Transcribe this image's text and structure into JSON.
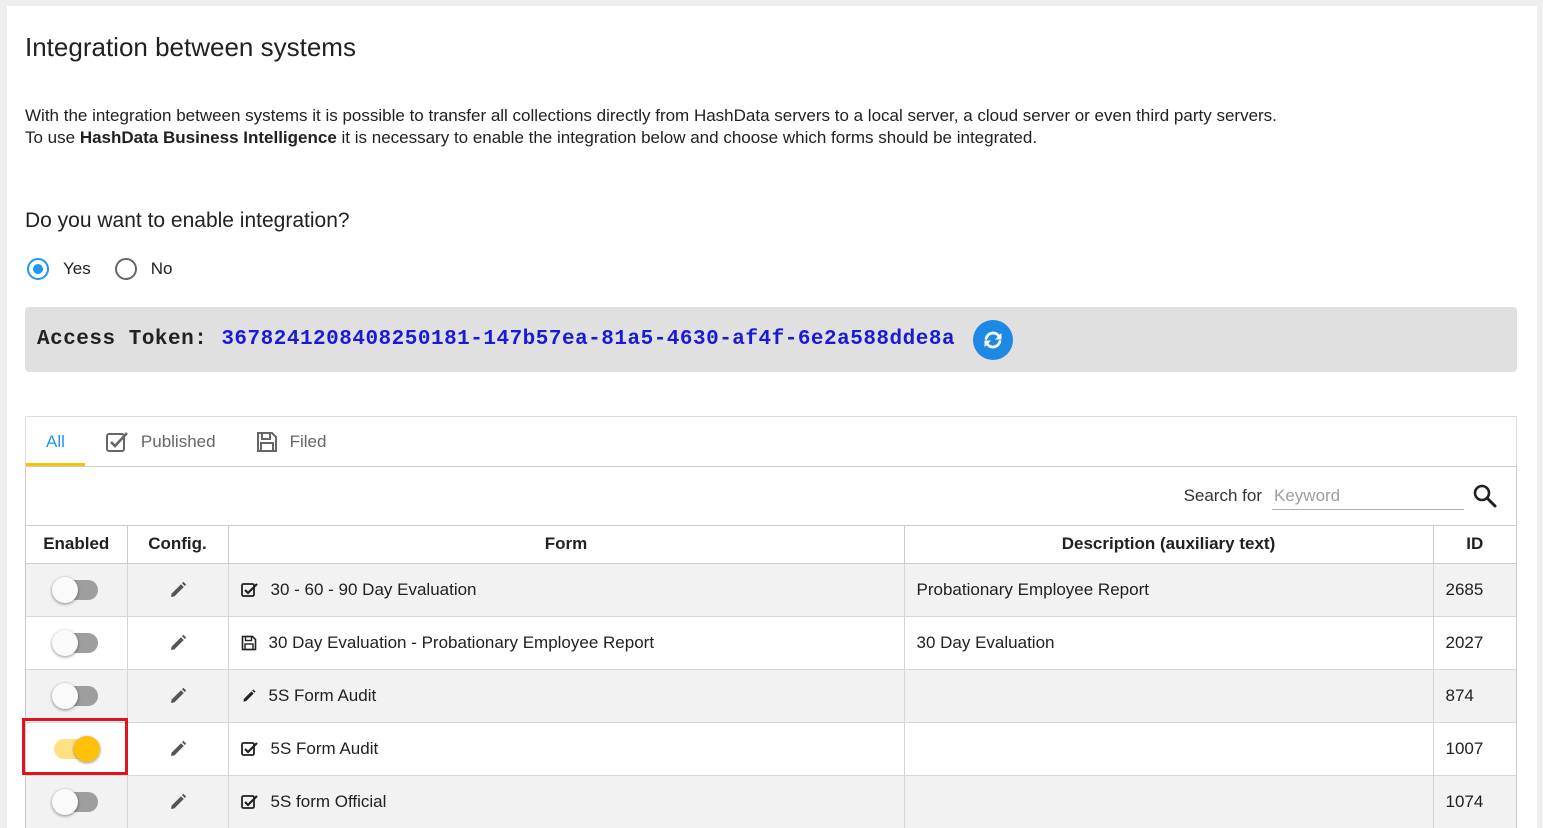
{
  "page": {
    "title": "Integration between systems",
    "intro_line1": "With the integration between systems it is possible to transfer all collections directly from HashData servers to a local server, a cloud server or even third party servers.",
    "intro_line2_prefix": "To use ",
    "intro_line2_bold": "HashData Business Intelligence",
    "intro_line2_suffix": " it is necessary to enable the integration below and choose which forms should be integrated."
  },
  "integration": {
    "question": "Do you want to enable integration?",
    "options": [
      {
        "label": "Yes",
        "checked": true
      },
      {
        "label": "No",
        "checked": false
      }
    ]
  },
  "token": {
    "label": "Access Token:",
    "value": "3678241208408250181-147b57ea-81a5-4630-af4f-6e2a588dde8a",
    "refresh_icon": "refresh-icon"
  },
  "tabs": [
    {
      "label": "All",
      "icon": "",
      "active": true
    },
    {
      "label": "Published",
      "icon": "checkbox-icon",
      "active": false
    },
    {
      "label": "Filed",
      "icon": "floppy-disk-icon",
      "active": false
    }
  ],
  "search": {
    "label": "Search for",
    "placeholder": "Keyword",
    "icon": "search-icon"
  },
  "table": {
    "headers": [
      "Enabled",
      "Config.",
      "Form",
      "Description (auxiliary text)",
      "ID"
    ],
    "rows": [
      {
        "enabled": false,
        "form_icon": "checkbox-icon",
        "form": "30 - 60 - 90 Day Evaluation",
        "description": "Probationary Employee Report",
        "id": "2685"
      },
      {
        "enabled": false,
        "form_icon": "floppy-disk-icon",
        "form": "30 Day Evaluation - Probationary Employee Report",
        "description": "30 Day Evaluation",
        "id": "2027"
      },
      {
        "enabled": false,
        "form_icon": "pencil-icon",
        "form": "5S Form Audit",
        "description": "",
        "id": "874"
      },
      {
        "enabled": true,
        "form_icon": "checkbox-icon",
        "form": "5S Form Audit",
        "description": "",
        "id": "1007"
      },
      {
        "enabled": false,
        "form_icon": "checkbox-icon",
        "form": "5S form Official",
        "description": "",
        "id": "1074"
      }
    ]
  },
  "colors": {
    "accent_blue": "#2196f3",
    "token_blue": "#1a1ad6",
    "tab_underline": "#f5c400",
    "toggle_on": "#ffc107",
    "highlight_red": "#e0141e"
  }
}
